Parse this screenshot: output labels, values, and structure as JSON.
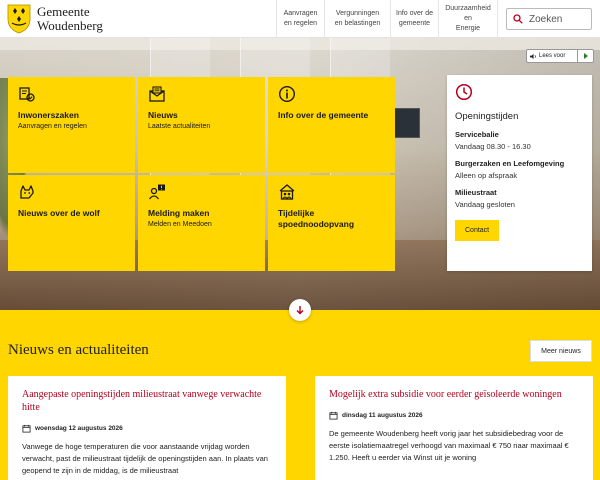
{
  "header": {
    "logo_line1": "Gemeente",
    "logo_line2": "Woudenberg",
    "nav": [
      {
        "line1": "Aanvragen",
        "line2": "en regelen"
      },
      {
        "line1": "Vergunningen",
        "line2": "en belastingen"
      },
      {
        "line1": "Info over de",
        "line2": "gemeente"
      },
      {
        "line1": "Duurzaamheid",
        "line2": "en",
        "line3": "Energie"
      }
    ],
    "search_placeholder": "Zoeken"
  },
  "readspeaker": {
    "label": "Lees voor"
  },
  "tiles": [
    {
      "icon": "permit-icon",
      "title": "Inwonerszaken",
      "subtitle": "Aanvragen en regelen"
    },
    {
      "icon": "newsletter-icon",
      "title": "Nieuws",
      "subtitle": "Laatste actualiteiten"
    },
    {
      "icon": "info-icon",
      "title": "Info over de gemeente",
      "subtitle": ""
    },
    {
      "icon": "wolf-icon",
      "title": "Nieuws over de wolf",
      "subtitle": ""
    },
    {
      "icon": "report-icon",
      "title": "Melding maken",
      "subtitle": "Melden en Meedoen"
    },
    {
      "icon": "childcare-icon",
      "title": "Tijdelijke spoednoodopvang",
      "subtitle": ""
    }
  ],
  "hours": {
    "title": "Openingstijden",
    "entries": [
      {
        "label": "Servicebalie",
        "value": "Vandaag 08.30 - 16.30"
      },
      {
        "label": "Burgerzaken en Leefomgeving",
        "value": "Alleen op afspraak"
      },
      {
        "label": "Milieustraat",
        "value": "Vandaag gesloten"
      }
    ],
    "contact_label": "Contact"
  },
  "news": {
    "heading": "Nieuws en actualiteiten",
    "more_label": "Meer nieuws",
    "items": [
      {
        "title": "Aangepaste openingstijden milieustraat vanwege verwachte hitte",
        "date": "woensdag 12 augustus 2026",
        "text": "Vanwege de hoge temperaturen die voor aanstaande vrijdag worden verwacht, past de milieustraat tijdelijk de openingstijden aan. In plaats van geopend te zijn in de middag, is de milieustraat"
      },
      {
        "title": "Mogelijk extra subsidie voor eerder geïsoleerde woningen",
        "date": "dinsdag 11 augustus 2026",
        "text": "De gemeente Woudenberg heeft vorig jaar het subsidiebedrag voor de eerste isolatiemaatregel verhoogd van maximaal € 750 naar maximaal € 1.250. Heeft u eerder via Winst uit je woning"
      }
    ]
  },
  "colors": {
    "brand_yellow": "#ffd600",
    "news_title_red": "#b3001e"
  }
}
